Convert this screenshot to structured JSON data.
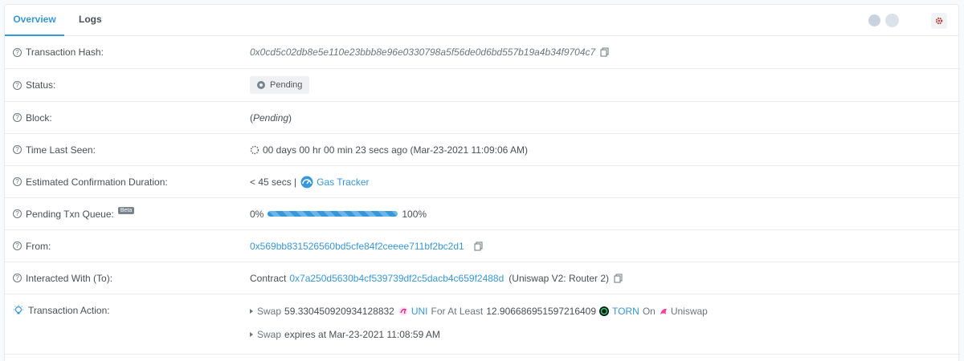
{
  "tabs": [
    {
      "label": "Overview",
      "active": true
    },
    {
      "label": "Logs",
      "active": false
    }
  ],
  "colors": {
    "accent": "#3498db",
    "border": "#e7eaf3",
    "gear": "#c0392b"
  },
  "rows": {
    "tx_hash": {
      "label": "Transaction Hash:",
      "value": "0x0cd5c02db8e5e110e23bbb8e96e0330798a5f56de0d6bd557b19a4b34f9704c7"
    },
    "status": {
      "label": "Status:",
      "value": "Pending"
    },
    "block": {
      "label": "Block:",
      "value_pre": "(",
      "value": "Pending",
      "value_post": ")"
    },
    "time": {
      "label": "Time Last Seen:",
      "value": "00 days 00 hr 00 min 23 secs ago (Mar-23-2021 11:09:06 AM)"
    },
    "duration": {
      "label": "Estimated Confirmation Duration:",
      "value": "< 45 secs |",
      "link": "Gas Tracker"
    },
    "queue": {
      "label": "Pending Txn Queue:",
      "badge": "Beta",
      "start": "0%",
      "end": "100%",
      "progress": 1.0
    },
    "from": {
      "label": "From:",
      "value": "0x569bb831526560bd5cfe84f2ceeee711bf2bc2d1"
    },
    "to": {
      "label": "Interacted With (To):",
      "prefix": "Contract",
      "address": "0x7a250d5630b4cf539739df2c5dacb4c659f2488d",
      "name": "(Uniswap V2: Router 2)"
    },
    "action": {
      "label": "Transaction Action:",
      "line1": {
        "verb": "Swap",
        "amount_in": "59.330450920934128832",
        "token_in": "UNI",
        "mid": "For At Least",
        "amount_out": "12.906686951597216409",
        "token_out": "TORN",
        "on": "On",
        "dex": "Uniswap"
      },
      "line2": {
        "verb": "Swap",
        "text": "expires at Mar-23-2021 11:08:59 AM"
      }
    }
  },
  "icons": [
    "question-circle-icon",
    "copy-icon",
    "spinner-icon",
    "gas-gauge-icon",
    "lightbulb-icon",
    "gear-icon",
    "uni-token-icon",
    "torn-token-icon",
    "uniswap-icon"
  ]
}
